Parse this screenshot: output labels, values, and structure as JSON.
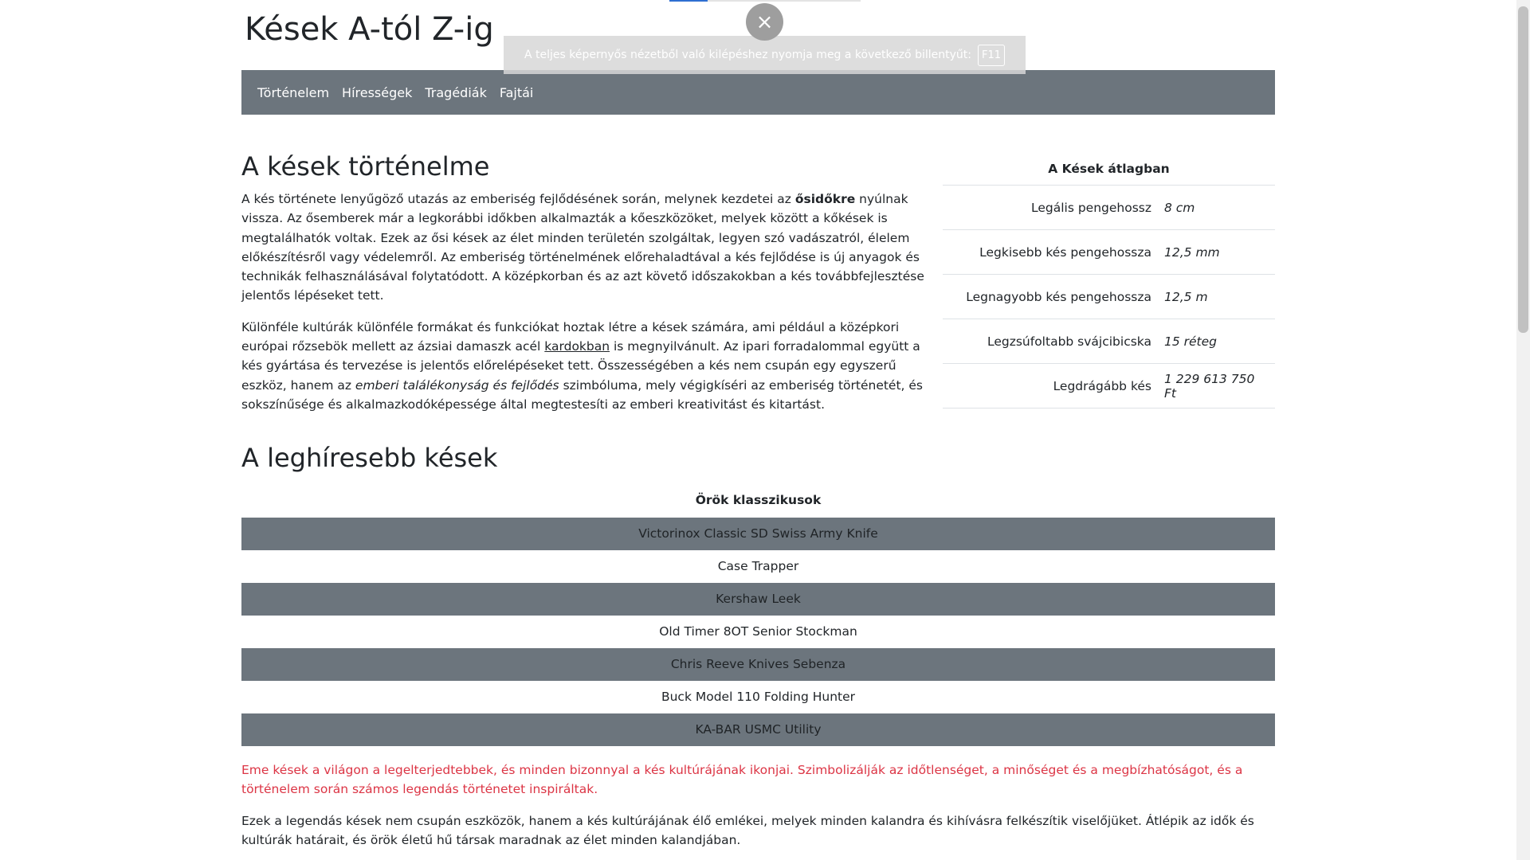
{
  "site": {
    "title": "Kések A-tól Z-ig"
  },
  "nav": {
    "items": [
      "Történelem",
      "Hírességek",
      "Tragédiák",
      "Fajtái"
    ]
  },
  "history": {
    "heading": "A kések történelme",
    "p1": {
      "before": "A kés története lenyűgöző utazás az emberiség fejlődésének során, melynek kezdetei az ",
      "bold": "ősidőkre",
      "after": " nyúlnak vissza. Az ősemberek már a legkorábbi időkben alkalmazták a kőeszközöket, melyek között a kőkések is megtalálhatók voltak. Ezek az ősi kések az élet minden területén szolgáltak, legyen szó vadászatról, élelem előkészítésről vagy védelemről. Az emberiség történelmének előrehaladtával a kés fejlődése is új anyagok és technikák felhasználásával folytatódott. A középkorban és az azt követő időszakokban a kés továbbfejlesztése jelentős lépéseket tett."
    },
    "p2": {
      "before": "Különféle kultúrák különféle formákat és funkciókat hoztak létre a kések számára, ami például a középkori európai rőzsebök mellett az ázsiai damaszk acél ",
      "link": "kardokban",
      "middle": " is megnyilvánult. Az ipari forradalommal együtt a kés gyártása és tervezése is jelentős előrelépéseket tett. Összességében a kés nem csupán egy egyszerű eszköz, hanem az ",
      "italic": "emberi találékonyság és fejlődés",
      "after": " szimbóluma, mely végigkíséri az emberiség történetét, és sokszínűsége és alkalmazkodóképessége által megtestesíti az emberi kreativitást és kitartást."
    }
  },
  "stats": {
    "caption": "A Kések átlagban",
    "rows": [
      {
        "label": "Legális pengehossz",
        "value": "8 cm"
      },
      {
        "label": "Legkisebb kés pengehossza",
        "value": "12,5 mm"
      },
      {
        "label": "Legnagyobb kés pengehossza",
        "value": "12,5 m"
      },
      {
        "label": "Legzsúfoltabb svájcibicska",
        "value": "15 réteg"
      },
      {
        "label": "Legdrágább kés",
        "value": "1 229 613 750 Ft"
      }
    ]
  },
  "famous": {
    "heading": "A leghíresebb kések",
    "caption": "Örök klasszikusok",
    "knives": [
      "Victorinox Classic SD Swiss Army Knife",
      "Case Trapper",
      "Kershaw Leek",
      "Old Timer 8OT Senior Stockman",
      "Chris Reeve Knives Sebenza",
      "Buck Model 110 Folding Hunter",
      "KA-BAR USMC Utility"
    ],
    "note_red": "Eme kések a világon a legelterjedtebbek, és minden bizonnyal a kés kultúrájának ikonjai. Szimbolizálják az időtlenséget, a minőséget és a megbízhatóságot, és a történelem során számos legendás történetet inspiráltak.",
    "note_plain": "Ezek a legendás kések nem csupán eszközök, hanem a kés kultúrájának élő emlékei, melyek minden kalandra és kihívásra felkészítik viselőjüket. Átlépik az idők és kultúrák határait, és örök életű hű társak maradnak az élet minden kalandjában."
  },
  "fullscreen": {
    "message": "A teljes képernyős nézetből való kilépéshez nyomja meg a következő billentyűt:",
    "key": "F11",
    "close_glyph": "×"
  },
  "colors": {
    "nav_bg": "#6c757d",
    "red_text": "#dc3545"
  }
}
